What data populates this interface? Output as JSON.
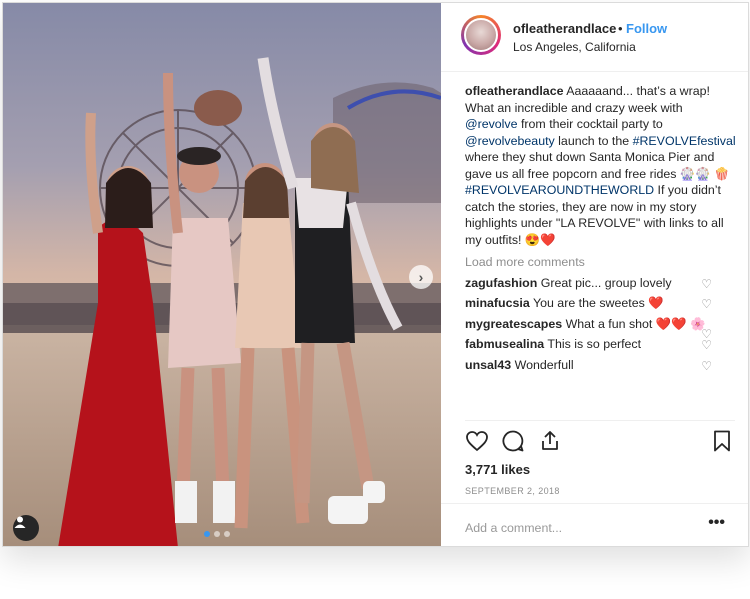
{
  "post": {
    "username": "ofleatherandlace",
    "separator": "•",
    "follow_label": "Follow",
    "location": "Los Angeles, California"
  },
  "caption": {
    "username": "ofleatherandlace",
    "part1": " Aaaaaand... that’s a wrap! What an incredible and crazy week with ",
    "mention1": "@revolve",
    "part2": " from their cocktail party to ",
    "mention2": "@revolvebeauty",
    "part3": " launch to the ",
    "hashtag1": "#REVOLVEfestival",
    "part4": " where they shut down Santa Monica Pier and gave us all free popcorn and free rides 🎡🎡 🍿 ",
    "hashtag2": "#REVOLVEAROUNDTHEWORLD",
    "part5": " If you didn’t catch the stories, they are now in my story highlights under \"LA REVOLVE\" with links to all my outfits! 😍❤️"
  },
  "load_more": "Load more comments",
  "comments": [
    {
      "user": "zagufashion",
      "text": "Great pic... group lovely"
    },
    {
      "user": "minafucsia",
      "text": "You are the sweetes ❤️"
    },
    {
      "user": "mygreatescapes",
      "text": "What a fun shot ❤️❤️ 🌸"
    },
    {
      "user": "fabmusealina",
      "text": "This is so perfect"
    },
    {
      "user": "unsal43",
      "text": "Wonderfull"
    }
  ],
  "likes": "3,771 likes",
  "date": "SEPTEMBER 2, 2018",
  "add_comment_placeholder": "Add a comment...",
  "more_label": "•••",
  "icons": {
    "like": "heart-icon",
    "comment": "comment-icon",
    "share": "share-icon",
    "save": "bookmark-icon",
    "next": "chevron-right-icon",
    "user_tag": "user-icon",
    "comment_like": "heart-outline-icon"
  },
  "colors": {
    "link": "#003569",
    "follow": "#3897f0",
    "muted": "#8e8e8e"
  }
}
